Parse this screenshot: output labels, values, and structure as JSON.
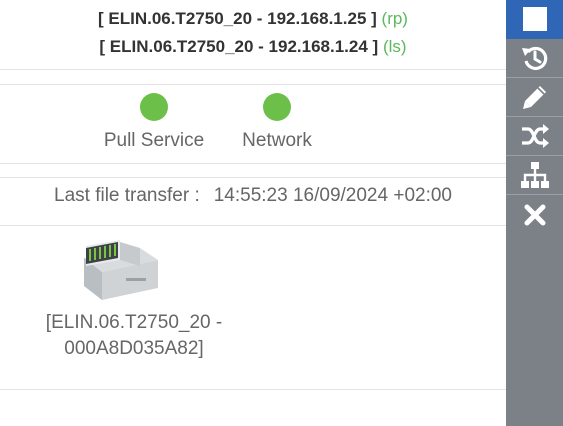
{
  "header": {
    "line1": {
      "text": "[ ELIN.06.T2750_20 - 192.168.1.25 ]",
      "role": "(rp)"
    },
    "line2": {
      "text": "[ ELIN.06.T2750_20 - 192.168.1.24 ]",
      "role": "(ls)"
    }
  },
  "statuses": [
    {
      "label": "Pull Service",
      "color": "#6cc04a"
    },
    {
      "label": "Network",
      "color": "#6cc04a"
    }
  ],
  "transfer": {
    "label": "Last file transfer :",
    "value": "14:55:23 16/09/2024 +02:00"
  },
  "device": {
    "label_line1": "[ELIN.06.T2750_20 -",
    "label_line2": "000A8D035A82]"
  },
  "sidebar": {
    "items": [
      {
        "icon": "square-icon",
        "active": true
      },
      {
        "icon": "history-icon"
      },
      {
        "icon": "pencil-icon"
      },
      {
        "icon": "shuffle-icon"
      },
      {
        "icon": "sitemap-icon"
      },
      {
        "icon": "close-icon"
      }
    ]
  },
  "colors": {
    "sidebar_bg": "#7b8187",
    "sidebar_active": "#2f66b6",
    "status_ok": "#6cc04a",
    "role_text": "#5cb85c"
  }
}
